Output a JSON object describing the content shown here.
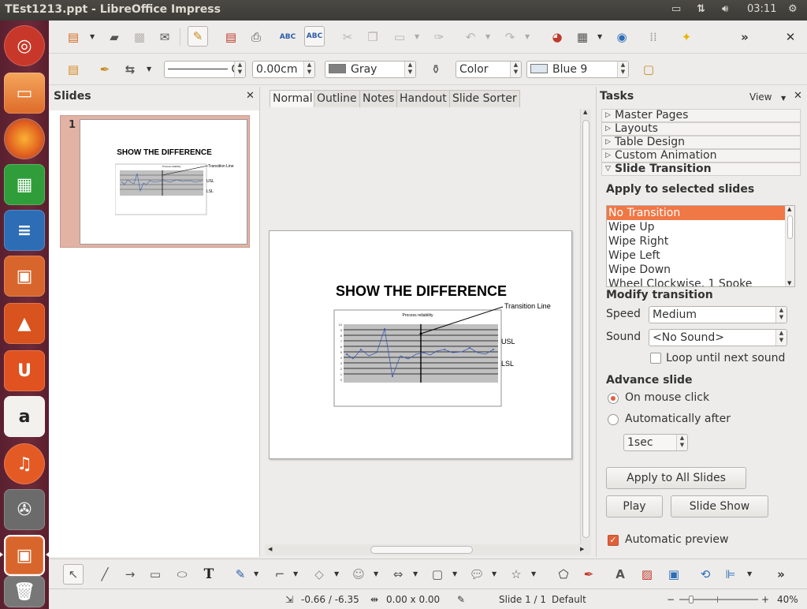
{
  "window": {
    "title": "TEst1213.ppt - LibreOffice Impress",
    "clock": "03:11"
  },
  "launcher": {
    "items": [
      "Ubuntu Dash",
      "Files",
      "Firefox",
      "LibreOffice Calc",
      "LibreOffice Writer",
      "LibreOffice Impress",
      "Ubuntu Software Center",
      "Ubuntu One",
      "Amazon",
      "Ubuntu One Music",
      "System Settings",
      "LibreOffice Impress (running)",
      "Trash"
    ]
  },
  "format_toolbar": {
    "line_width": "0.00cm",
    "line_style_suffix": "C",
    "line_color": "Gray",
    "area_style": "Color",
    "area_color": "Blue 9",
    "colors": {
      "gray": "#808080",
      "blue9": "#dee6ef"
    }
  },
  "slides_panel": {
    "title": "Slides",
    "close": "✕",
    "slide_number": "1"
  },
  "view_tabs": [
    "Normal",
    "Outline",
    "Notes",
    "Handout",
    "Slide Sorter"
  ],
  "slide": {
    "title": "SHOW THE DIFFERENCE",
    "chart_title": "Process reliability",
    "annotation": "Transition Line",
    "usl": "USL",
    "lsl": "LSL",
    "y_ticks": [
      "10",
      "9",
      "8",
      "7",
      "6",
      "5",
      "4",
      "3",
      "2",
      "1",
      "0"
    ]
  },
  "tasks_panel": {
    "title": "Tasks",
    "view_label": "View",
    "close": "✕",
    "decks": [
      "Master Pages",
      "Layouts",
      "Table Design",
      "Custom Animation",
      "Slide Transition"
    ],
    "apply_heading": "Apply to selected slides",
    "transitions": [
      "No Transition",
      "Wipe Up",
      "Wipe Right",
      "Wipe Left",
      "Wipe Down",
      "Wheel Clockwise, 1 Spoke"
    ],
    "modify_heading": "Modify transition",
    "speed_label": "Speed",
    "speed_value": "Medium",
    "sound_label": "Sound",
    "sound_value": "<No Sound>",
    "loop_label": "Loop until next sound",
    "advance_heading": "Advance slide",
    "on_click_label": "On mouse click",
    "auto_label": "Automatically after",
    "auto_value": "1sec",
    "apply_all_button": "Apply to All Slides",
    "play_button": "Play",
    "slideshow_button": "Slide Show",
    "auto_preview_label": "Automatic preview",
    "accent": "#f07746"
  },
  "status_bar": {
    "position": "-0.66 / -6.35",
    "size": "0.00 x 0.00",
    "slide": "Slide 1 / 1",
    "layout": "Default",
    "zoom": "40%"
  }
}
